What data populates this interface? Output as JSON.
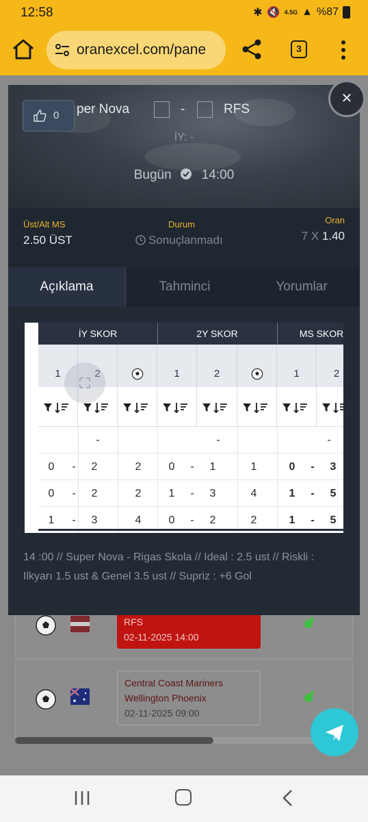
{
  "status_bar": {
    "time": "12:58",
    "battery": "%87",
    "network": "4.5G"
  },
  "browser": {
    "url": "oranexcel.com/pane",
    "tab_count": "3"
  },
  "background_page": {
    "matches": [
      {
        "teams": [
          "RFS"
        ],
        "date": "02-11-2025 14:00",
        "highlight": true
      },
      {
        "teams": [
          "Central Coast Mariners",
          "Wellington Phoenix"
        ],
        "date": "02-11-2025 09:00",
        "highlight": false
      }
    ]
  },
  "modal": {
    "like_count": "0",
    "home_team": "per Nova",
    "score_dash": "-",
    "away_team": "RFS",
    "half_time": "İY: -",
    "day": "Bugün",
    "time": "14:00",
    "info": {
      "bet_label": "Üst/Alt MS",
      "bet_value": "2.50 ÜST",
      "status_label": "Durum",
      "status_value": "Sonuçlanmadı",
      "odds_label": "Oran",
      "odds_count": "7",
      "odds_x": "X",
      "odds_value": "1.40"
    },
    "tabs": [
      {
        "label": "Açıklama",
        "active": true
      },
      {
        "label": "Tahminci",
        "active": false
      },
      {
        "label": "Yorumlar",
        "active": false
      }
    ],
    "table": {
      "groups": [
        "İY SKOR",
        "2Y SKOR",
        "MS SKOR"
      ],
      "sub_headers": [
        "1",
        "2",
        "⚽",
        "1",
        "2",
        "⚽",
        "1",
        "2"
      ],
      "rows": [
        [
          "",
          "-",
          "",
          "",
          "-",
          "",
          "",
          "-",
          ""
        ],
        [
          "0",
          "-",
          "2",
          "2",
          "0",
          "-",
          "1",
          "1",
          "0",
          "-",
          "3"
        ],
        [
          "0",
          "-",
          "2",
          "2",
          "1",
          "-",
          "3",
          "4",
          "1",
          "-",
          "5"
        ],
        [
          "1",
          "-",
          "3",
          "4",
          "0",
          "-",
          "2",
          "2",
          "1",
          "-",
          "5"
        ]
      ]
    },
    "description": "14 :00 // Super Nova - Rigas Skola // Ideal : 2.5 ust // Riskli : Ilkyarı 1.5 ust & Genel 3.5 ust // Supriz : +6 Gol"
  },
  "colors": {
    "browser_bar": "#f6b819",
    "modal_bg": "#222a34",
    "accent_gold": "#e8b62c",
    "fab": "#2ec7d6"
  }
}
